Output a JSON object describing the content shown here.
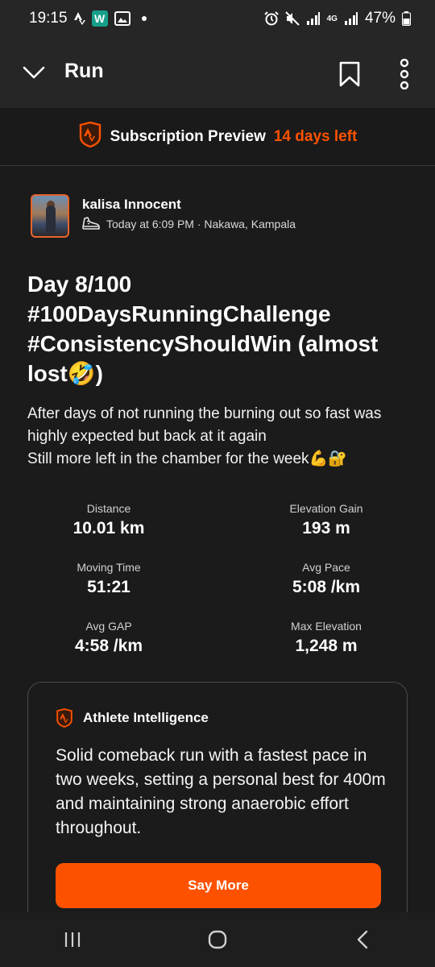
{
  "status_bar": {
    "time": "19:15",
    "network": "4G",
    "battery": "47%"
  },
  "app_bar": {
    "title": "Run"
  },
  "subscription": {
    "label": "Subscription Preview",
    "days_left": "14 days left"
  },
  "activity": {
    "athlete_name": "kalisa Innocent",
    "timestamp_location": "Today at 6:09 PM · Nakawa, Kampala",
    "title": "Day 8/100 #100DaysRunningChallenge #ConsistencyShouldWin (almost lost🤣)",
    "description": "After days of not running the burning out so fast was highly expected but back at it again\nStill more left in the chamber for the week💪🔐"
  },
  "stats": [
    {
      "label": "Distance",
      "value": "10.01 km"
    },
    {
      "label": "Elevation Gain",
      "value": "193 m"
    },
    {
      "label": "Moving Time",
      "value": "51:21"
    },
    {
      "label": "Avg Pace",
      "value": "5:08 /km"
    },
    {
      "label": "Avg GAP",
      "value": "4:58 /km"
    },
    {
      "label": "Max Elevation",
      "value": "1,248 m"
    }
  ],
  "athlete_intelligence": {
    "title": "Athlete Intelligence",
    "summary": "Solid comeback run with a fastest pace in two weeks, setting a personal best for 400m and maintaining strong anaerobic effort throughout.",
    "button_label": "Say More"
  },
  "colors": {
    "accent": "#fc5200",
    "background": "#1b1b1b",
    "app_bar": "#262626"
  },
  "icons": [
    "chevron-down-icon",
    "bookmark-icon",
    "more-vertical-icon",
    "strava-badge-icon",
    "shoe-icon",
    "recents-icon",
    "home-icon",
    "back-icon"
  ]
}
